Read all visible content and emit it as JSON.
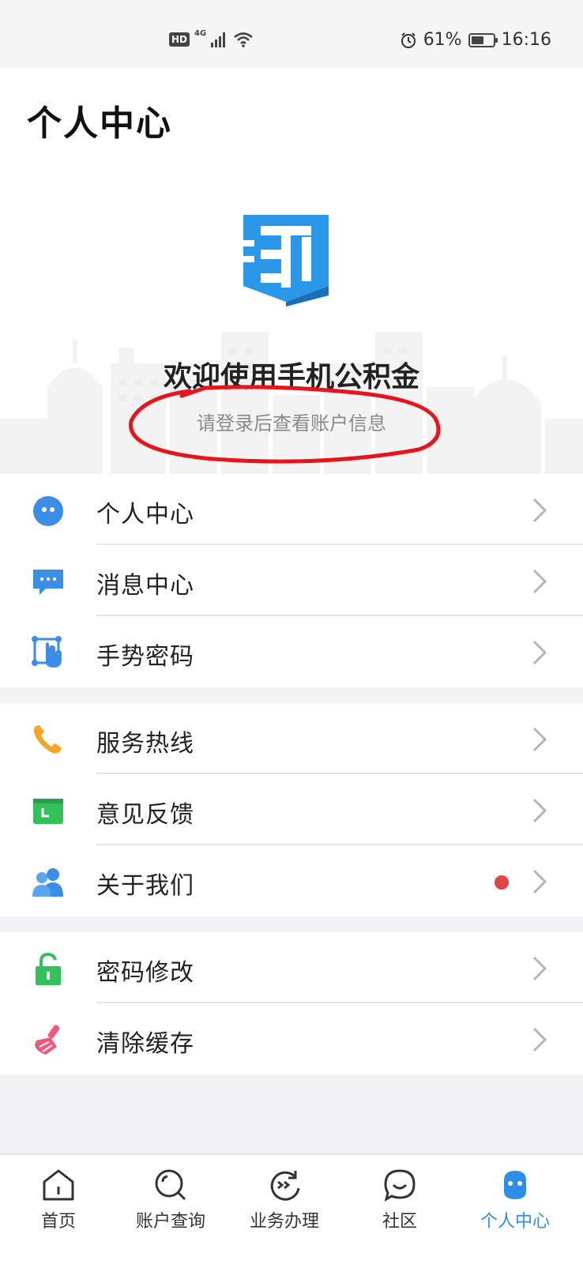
{
  "status_bar": {
    "left_badge": "HD",
    "network": "4G",
    "battery": "61%",
    "time": "16:16"
  },
  "header": {
    "title": "个人中心"
  },
  "hero": {
    "welcome": "欢迎使用手机公积金",
    "subtitle": "请登录后查看账户信息"
  },
  "menu_groups": [
    {
      "items": [
        {
          "label": "个人中心",
          "icon": "avatar-icon"
        },
        {
          "label": "消息中心",
          "icon": "message-icon"
        },
        {
          "label": "手势密码",
          "icon": "gesture-icon"
        }
      ]
    },
    {
      "items": [
        {
          "label": "服务热线",
          "icon": "phone-icon"
        },
        {
          "label": "意见反馈",
          "icon": "feedback-icon"
        },
        {
          "label": "关于我们",
          "icon": "about-us-icon",
          "badge": true
        }
      ]
    },
    {
      "items": [
        {
          "label": "密码修改",
          "icon": "lock-icon"
        },
        {
          "label": "清除缓存",
          "icon": "brush-icon"
        }
      ]
    }
  ],
  "bottom_nav": [
    {
      "label": "首页",
      "icon": "home-icon"
    },
    {
      "label": "账户查询",
      "icon": "search-icon"
    },
    {
      "label": "业务办理",
      "icon": "business-icon"
    },
    {
      "label": "社区",
      "icon": "chat-icon"
    },
    {
      "label": "个人中心",
      "icon": "person-icon",
      "active": true
    }
  ],
  "colors": {
    "accent": "#2e8ee6",
    "annotation": "#e8141c",
    "badge": "#e04646"
  }
}
